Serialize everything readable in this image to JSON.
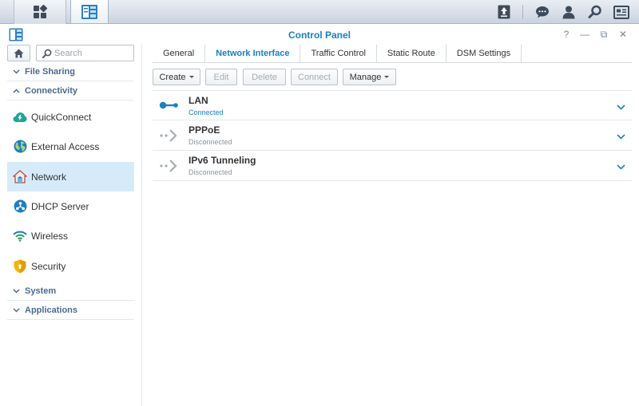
{
  "taskbar": {
    "main_menu_icon": "grid-icon",
    "app_icon": "control-panel-icon",
    "right_icons": [
      "upload-icon",
      "chat-icon",
      "user-icon",
      "search-icon",
      "widgets-icon"
    ]
  },
  "window": {
    "title": "Control Panel",
    "controls": {
      "help": "?",
      "minimize": "—",
      "restore": "⧉",
      "close": "✕"
    }
  },
  "sidebar": {
    "search_placeholder": "Search",
    "groups": {
      "file_sharing": "File Sharing",
      "connectivity": "Connectivity",
      "system": "System",
      "applications": "Applications"
    },
    "items": [
      {
        "label": "QuickConnect",
        "icon": "quickconnect-cloud-icon"
      },
      {
        "label": "External Access",
        "icon": "globe-icon"
      },
      {
        "label": "Network",
        "icon": "house-network-icon",
        "active": true
      },
      {
        "label": "DHCP Server",
        "icon": "dhcp-icon"
      },
      {
        "label": "Wireless",
        "icon": "wifi-icon"
      },
      {
        "label": "Security",
        "icon": "shield-icon"
      }
    ]
  },
  "tabs": [
    {
      "label": "General"
    },
    {
      "label": "Network Interface",
      "active": true
    },
    {
      "label": "Traffic Control"
    },
    {
      "label": "Static Route"
    },
    {
      "label": "DSM Settings"
    }
  ],
  "toolbar": {
    "create": "Create",
    "edit": "Edit",
    "delete": "Delete",
    "connect": "Connect",
    "manage": "Manage"
  },
  "interfaces": [
    {
      "name": "LAN",
      "status": "Connected",
      "connected": true
    },
    {
      "name": "PPPoE",
      "status": "Disconnected",
      "connected": false
    },
    {
      "name": "IPv6 Tunneling",
      "status": "Disconnected",
      "connected": false
    }
  ],
  "colors": {
    "accent": "#1a7fc4",
    "active_bg": "#d6ebfa",
    "group_label": "#4a6b8f"
  }
}
